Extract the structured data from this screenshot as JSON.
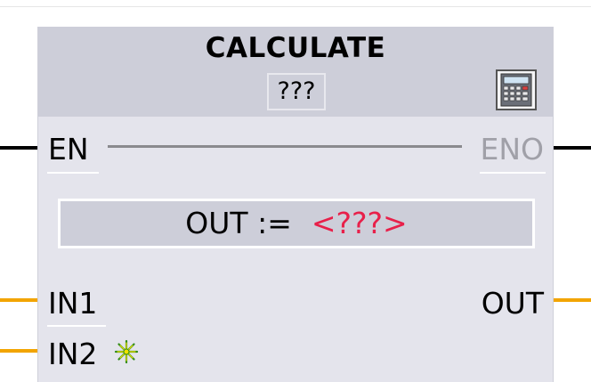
{
  "block": {
    "title": "CALCULATE",
    "instance_name": "???",
    "icon": "calculator-icon"
  },
  "pins": {
    "en": "EN",
    "eno": "ENO",
    "in1": "IN1",
    "in2": "IN2",
    "out": "OUT"
  },
  "formula": {
    "expression": "OUT :=",
    "placeholder": "<???>"
  },
  "add_input_icon": "add-input-star-icon",
  "colors": {
    "header_bg": "#cdced9",
    "body_bg": "#e4e4ec",
    "boolean_wire": "#000000",
    "data_wire": "#f2a400",
    "placeholder_text": "#e8204a",
    "eno_text": "#a0a0a8"
  }
}
